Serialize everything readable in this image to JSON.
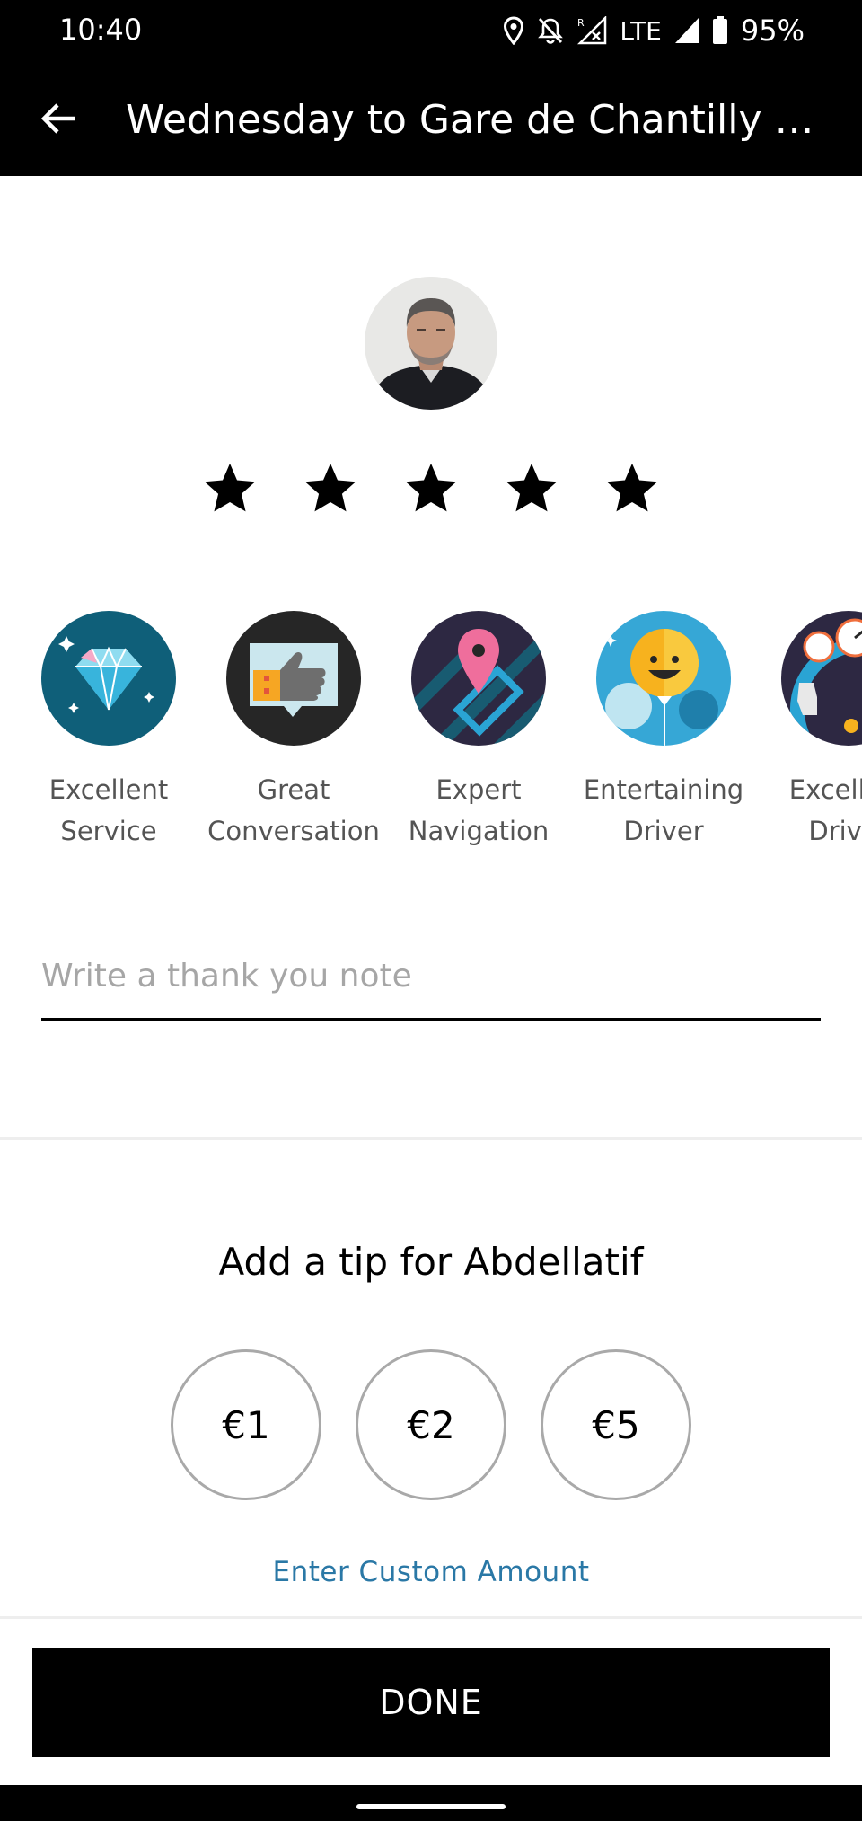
{
  "status_bar": {
    "time": "10:40",
    "network": "LTE",
    "battery": "95%",
    "icons": [
      "location-icon",
      "notifications-off-icon",
      "signal-roaming-icon",
      "signal-icon",
      "battery-icon"
    ]
  },
  "header": {
    "title": "Wednesday to Gare de Chantilly Go…",
    "back_icon": "arrow-left-icon"
  },
  "driver": {
    "avatar": "driver-photo"
  },
  "rating": {
    "stars": 5,
    "max_stars": 5
  },
  "compliments": [
    {
      "label": "Excellent Service",
      "icon": "diamond-icon"
    },
    {
      "label": "Great Conversation",
      "icon": "thumbs-up-icon"
    },
    {
      "label": "Expert Navigation",
      "icon": "map-pin-icon"
    },
    {
      "label": "Entertaining Driver",
      "icon": "smiley-balloon-icon"
    },
    {
      "label": "Excellent Driver",
      "icon": "steering-gauge-icon"
    }
  ],
  "note": {
    "placeholder": "Write a thank you note",
    "value": ""
  },
  "tip": {
    "heading": "Add a tip for Abdellatif",
    "options": [
      "€1",
      "€2",
      "€5"
    ],
    "custom_label": "Enter Custom Amount"
  },
  "footer": {
    "done_label": "DONE"
  },
  "colors": {
    "bar_background": "#000000",
    "link": "#2a78a6",
    "secondary_text": "#545454",
    "placeholder": "#a6a6a6",
    "tip_border": "#a9a9a9"
  }
}
